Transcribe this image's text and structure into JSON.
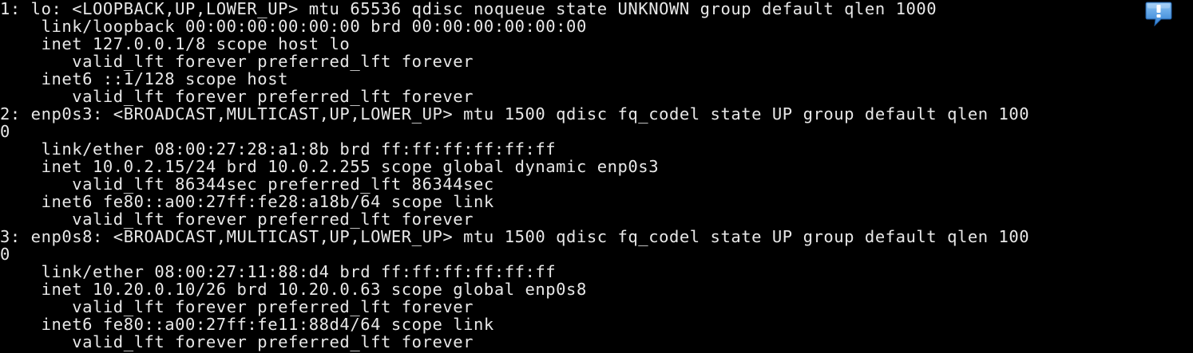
{
  "terminal": {
    "lines": [
      "1: lo: <LOOPBACK,UP,LOWER_UP> mtu 65536 qdisc noqueue state UNKNOWN group default qlen 1000",
      "    link/loopback 00:00:00:00:00:00 brd 00:00:00:00:00:00",
      "    inet 127.0.0.1/8 scope host lo",
      "       valid_lft forever preferred_lft forever",
      "    inet6 ::1/128 scope host",
      "       valid_lft forever preferred_lft forever",
      "2: enp0s3: <BROADCAST,MULTICAST,UP,LOWER_UP> mtu 1500 qdisc fq_codel state UP group default qlen 100",
      "0",
      "    link/ether 08:00:27:28:a1:8b brd ff:ff:ff:ff:ff:ff",
      "    inet 10.0.2.15/24 brd 10.0.2.255 scope global dynamic enp0s3",
      "       valid_lft 86344sec preferred_lft 86344sec",
      "    inet6 fe80::a00:27ff:fe28:a18b/64 scope link",
      "       valid_lft forever preferred_lft forever",
      "3: enp0s8: <BROADCAST,MULTICAST,UP,LOWER_UP> mtu 1500 qdisc fq_codel state UP group default qlen 100",
      "0",
      "    link/ether 08:00:27:11:88:d4 brd ff:ff:ff:ff:ff:ff",
      "    inet 10.20.0.10/26 brd 10.20.0.63 scope global enp0s8",
      "       valid_lft forever preferred_lft forever",
      "    inet6 fe80::a00:27ff:fe11:88d4/64 scope link",
      "       valid_lft forever preferred_lft forever"
    ]
  },
  "notification": {
    "icon": "notification-speech-bubble-icon",
    "glyph": "!",
    "color": "#3d8fe0"
  },
  "colors": {
    "background": "#000000",
    "text": "#e8e8e8"
  }
}
